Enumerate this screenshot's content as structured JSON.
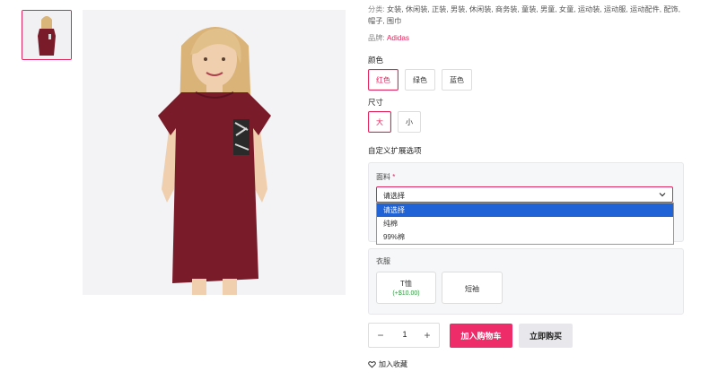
{
  "gallery": {
    "thumb_alt": "product thumbnail",
    "main_alt": "product main image"
  },
  "product": {
    "category_label": "分类:",
    "categories": "女装, 休闲装, 正装, 男装, 休闲装, 商务装, 童装, 男童, 女童, 运动装, 运动服, 运动配件, 配饰, 帽子, 围巾",
    "brand_label": "品牌:",
    "brand": "Adidas"
  },
  "color": {
    "title": "颜色",
    "options": [
      "红色",
      "绿色",
      "蓝色"
    ],
    "selected": "红色"
  },
  "size": {
    "title": "尺寸",
    "options": [
      "大",
      "小"
    ],
    "selected": "大"
  },
  "custom": {
    "title": "自定义扩展选项",
    "fabric": {
      "label": "面料",
      "required_mark": "*",
      "value": "请选择",
      "options": [
        "请选择",
        "纯棉",
        "99%棉"
      ]
    },
    "style": {
      "label": "衣服",
      "cards": [
        {
          "title": "T恤",
          "price": "(+$10.00)"
        },
        {
          "title": "短袖",
          "price": ""
        }
      ]
    }
  },
  "purchase": {
    "quantity": "1",
    "minus": "−",
    "plus": "+",
    "add_to_cart": "加入购物车",
    "buy_now": "立即购买",
    "favorite": "加入收藏"
  },
  "colors": {
    "accent": "#e0245e",
    "cart_button": "#ef2c6a",
    "dropdown_selected": "#1f63d6",
    "price_green": "#2e9a3e"
  }
}
